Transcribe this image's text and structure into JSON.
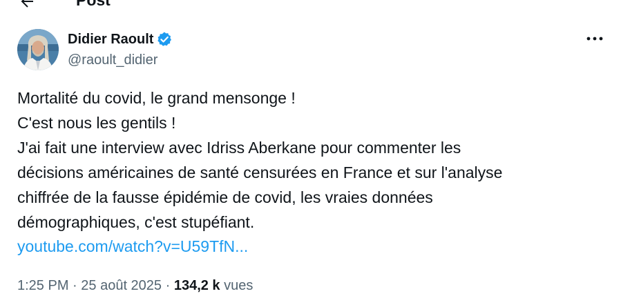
{
  "header": {
    "title": "Post",
    "back_icon": "arrow-left-icon"
  },
  "author": {
    "display_name": "Didier Raoult",
    "handle": "@raoult_didier",
    "verified_icon": "verified-badge-icon",
    "verified_color": "#1d9bf0",
    "more_icon": "more-horizontal-icon"
  },
  "tweet": {
    "text": "Mortalité du covid, le grand mensonge !\n C'est nous les gentils !\n J'ai fait une interview avec Idriss Aberkane pour commenter les\ndécisions américaines de santé censurées en France et sur l'analyse\nchiffrée de la fausse épidémie de covid, les vraies données\ndémographiques, c'est stupéfiant.",
    "link": "youtube.com/watch?v=U59TfN..."
  },
  "meta": {
    "time": "1:25 PM",
    "separator": " · ",
    "date": "25 août 2025",
    "views_count": "134,2 k",
    "views_label": " vues"
  },
  "colors": {
    "text": "#0f1419",
    "secondary": "#536471",
    "link": "#1d9bf0"
  }
}
